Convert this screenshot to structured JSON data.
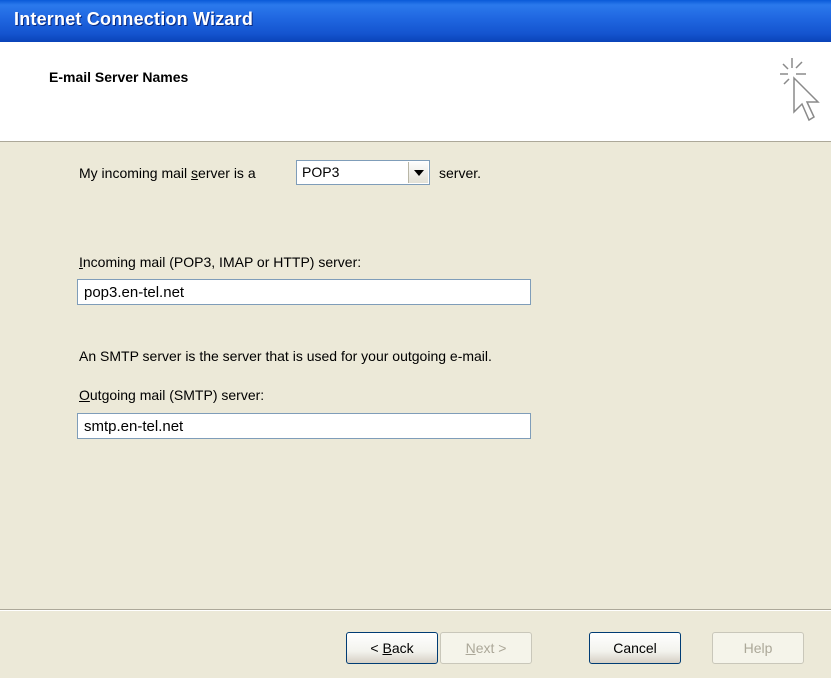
{
  "window": {
    "title": "Internet Connection Wizard"
  },
  "header": {
    "heading": "E-mail Server Names",
    "icon": "wizard-cursor-icon"
  },
  "form": {
    "incoming_type_prefix": "My incoming mail ",
    "incoming_type_hotkey": "s",
    "incoming_type_suffix": "erver is a",
    "incoming_type_value": "POP3",
    "incoming_type_after": "server.",
    "incoming_label_hotkey": "I",
    "incoming_label_rest": "ncoming mail (POP3, IMAP or HTTP) server:",
    "incoming_value": "pop3.en-tel.net",
    "smtp_info": "An SMTP server is the server that is used for your outgoing e-mail.",
    "outgoing_label_hotkey": "O",
    "outgoing_label_rest": "utgoing mail (SMTP) server:",
    "outgoing_value": "smtp.en-tel.net"
  },
  "buttons": {
    "back_prefix": "< ",
    "back_hotkey": "B",
    "back_rest": "ack",
    "next_hotkey": "N",
    "next_rest": "ext >",
    "cancel": "Cancel",
    "help": "Help"
  }
}
